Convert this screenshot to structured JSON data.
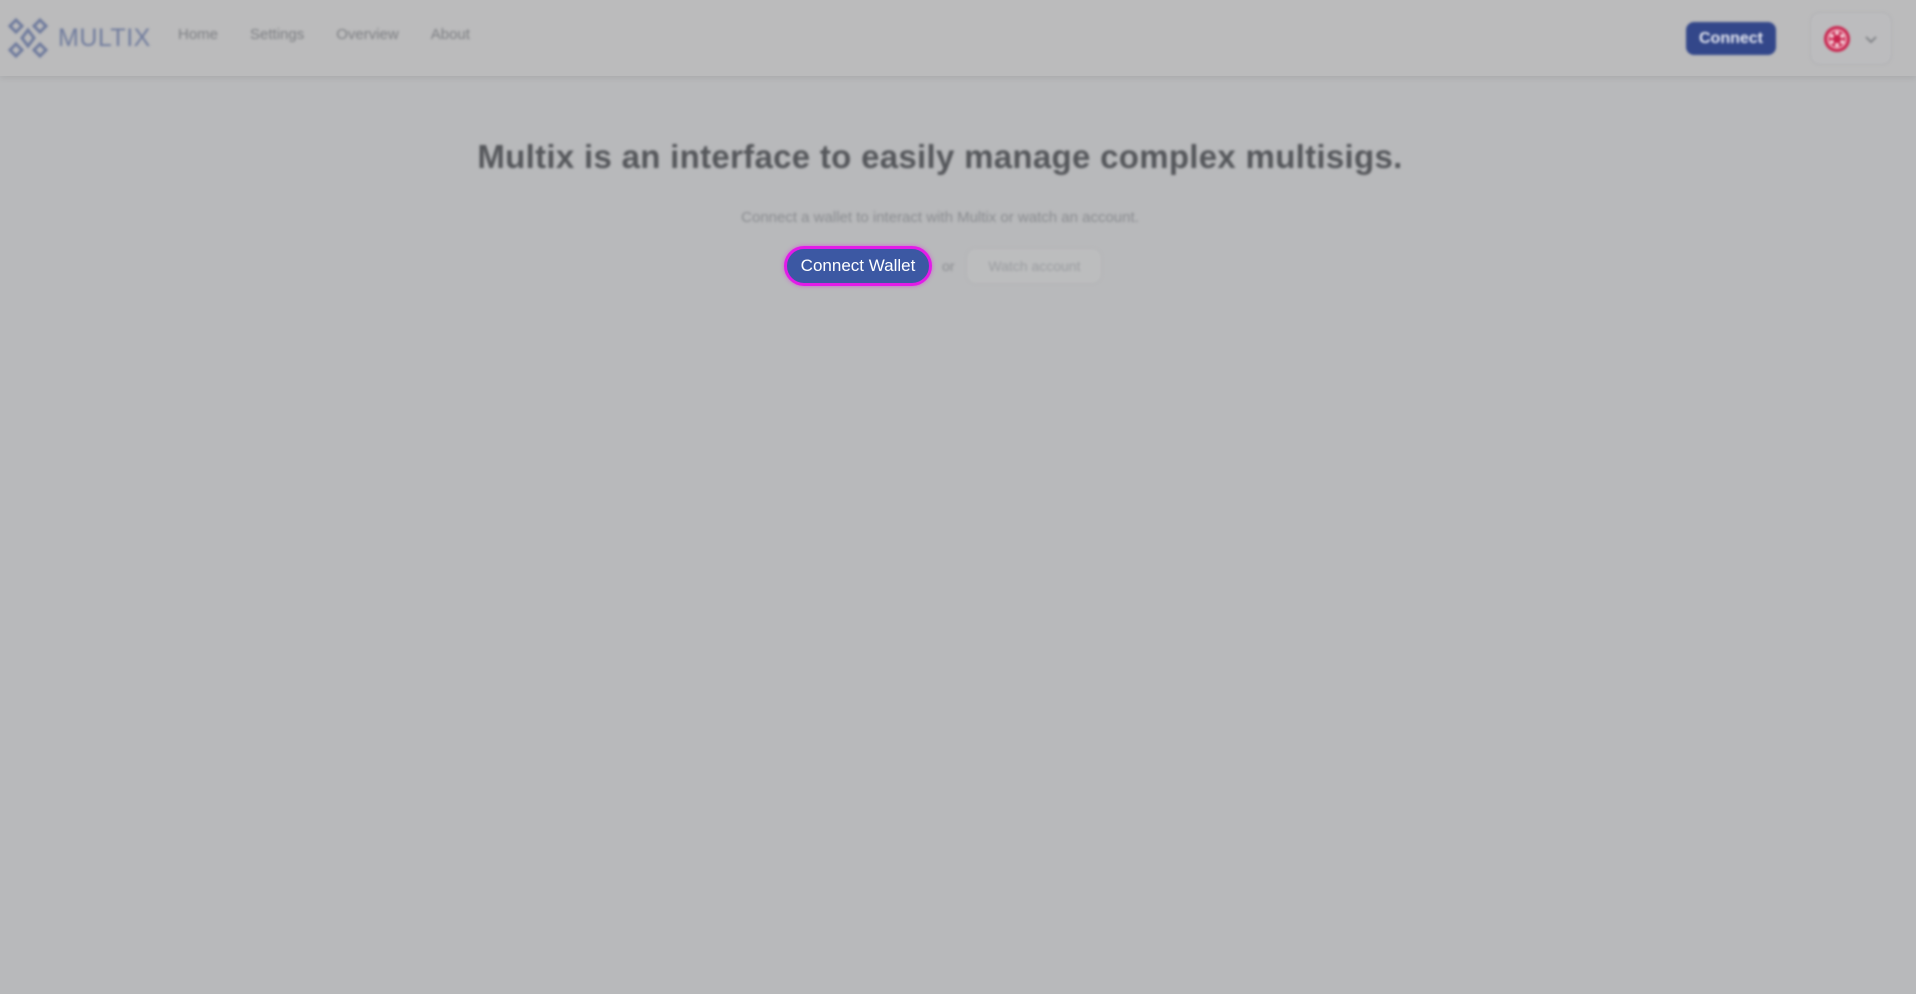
{
  "app": {
    "logo_text": "MULTIX"
  },
  "nav": {
    "items": [
      {
        "label": "Home"
      },
      {
        "label": "Settings"
      },
      {
        "label": "Overview"
      },
      {
        "label": "About"
      }
    ]
  },
  "header": {
    "connect_label": "Connect",
    "network_icon": "polkadot-network-icon",
    "dropdown_icon": "chevron-down-icon"
  },
  "hero": {
    "title": "Multix is an interface to easily manage complex multisigs.",
    "subtitle": "Connect a wallet to interact with Multix or watch an account.",
    "connect_wallet_label": "Connect Wallet",
    "or_text": "or",
    "watch_account_label": "Watch account"
  },
  "colors": {
    "overlay_bg": "#b8b9bb",
    "primary_button": "#3c58a3",
    "header_button": "#33478a",
    "focus_ring": "#e21be8",
    "network_accent": "#e6007a"
  }
}
